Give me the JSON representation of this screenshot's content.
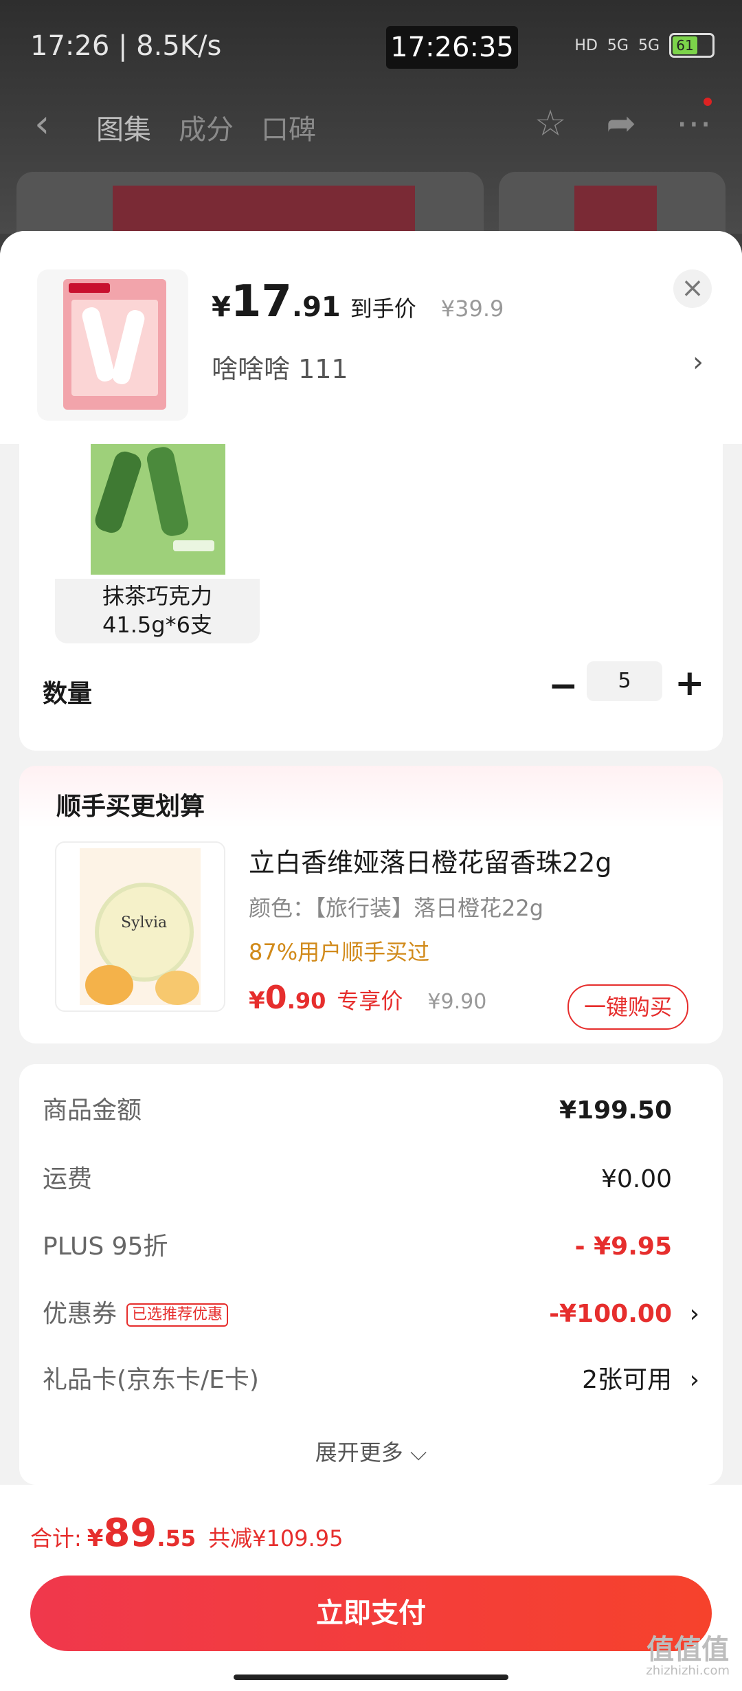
{
  "status_bar": {
    "left_text": "17:26 | 8.5K/s",
    "clock": "17:26:35",
    "net1": "HD",
    "net2": "5G",
    "net3": "5G",
    "battery": "61"
  },
  "nav": {
    "tabs": [
      "图集",
      "成分",
      "口碑"
    ]
  },
  "sheet": {
    "price": {
      "yen": "¥",
      "integer": "17",
      "decimal": ".91",
      "tag": "到手价",
      "original": "¥39.9"
    },
    "variant": "啥啥啥  111",
    "close_icon": "×",
    "sku": {
      "name_line1": "抹茶巧克力",
      "name_line2": "41.5g*6支"
    },
    "quantity": {
      "label": "数量",
      "value": "5"
    }
  },
  "upsell": {
    "title": "顺手买更划算",
    "product_name": "立白香维娅落日橙花留香珠22g",
    "spec": "颜色：【旅行装】落日橙花22g",
    "stat": "87%用户顺手买过",
    "price": {
      "yen": "¥",
      "integer": "0",
      "decimal": ".90",
      "tag": "专享价",
      "original": "¥9.90"
    },
    "buy_button": "一键购买",
    "brand_on_pack": "Sylvia"
  },
  "summary": {
    "rows": [
      {
        "label": "商品金额",
        "value": "¥199.50"
      },
      {
        "label": "运费",
        "value": "¥0.00"
      },
      {
        "label": "PLUS 95折",
        "value": "- ¥9.95"
      },
      {
        "label": "优惠券",
        "tag": "已选推荐优惠",
        "value": "-¥100.00"
      },
      {
        "label": "礼品卡(京东卡/E卡)",
        "value": "2张可用"
      }
    ],
    "expand": "展开更多 ⌵"
  },
  "footer": {
    "total_label": "合计:",
    "total_yen": "¥",
    "total_integer": "89",
    "total_decimal": ".55",
    "saved": "共减¥109.95",
    "pay_button": "立即支付"
  },
  "watermark": {
    "main": "值值值",
    "sub": "zhizhizhi.com"
  },
  "colors": {
    "accent_red": "#e62e2d",
    "pay_gradient_start": "#f0384c",
    "pay_gradient_end": "#f6422c",
    "stat_orange": "#d18a1a"
  }
}
